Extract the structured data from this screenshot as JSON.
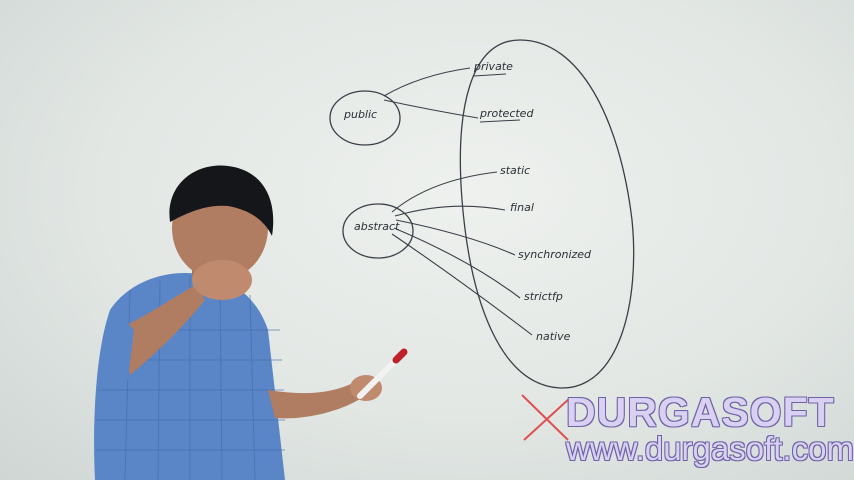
{
  "whiteboard": {
    "group_one": {
      "source": "public",
      "targets": [
        "private",
        "protected"
      ]
    },
    "group_two": {
      "source": "abstract",
      "targets": [
        "static",
        "final",
        "synchronized",
        "strictfp",
        "native"
      ]
    }
  },
  "watermark": {
    "brand": "DURGASOFT",
    "url": "www.durgasoft.com",
    "text_color": "#d9d0f2",
    "outline_color": "#6f63a8",
    "cross_color": "#e05050"
  },
  "marker_color": "#c0202a",
  "shirt_color": "#5a86c8"
}
